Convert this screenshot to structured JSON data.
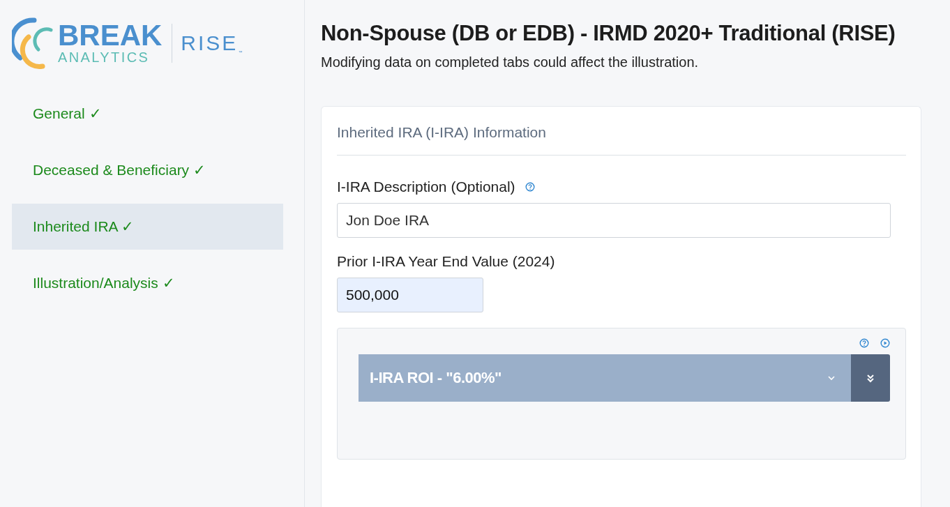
{
  "logo": {
    "brand": "BREAK",
    "subtitle": "ANALYTICS",
    "product": "RISE",
    "trademark": "™"
  },
  "nav": [
    {
      "label": "General",
      "status_icon": "✓",
      "completed": true,
      "selected": false
    },
    {
      "label": "Deceased & Beneficiary",
      "status_icon": "✓",
      "completed": true,
      "selected": false
    },
    {
      "label": "Inherited IRA",
      "status_icon": "✓",
      "completed": true,
      "selected": true
    },
    {
      "label": "Illustration/Analysis",
      "status_icon": "✓",
      "completed": true,
      "selected": false
    }
  ],
  "header": {
    "title": "Non-Spouse (DB or EDB) - IRMD 2020+ Traditional (RISE)",
    "subtitle": "Modifying data on completed tabs could affect the illustration."
  },
  "card": {
    "section_title": "Inherited IRA (I-IRA) Information",
    "fields": [
      {
        "label": "I-IRA Description (Optional)",
        "help": true,
        "value": "Jon Doe IRA",
        "kind": "text"
      },
      {
        "label": "Prior I-IRA Year End Value (2024)",
        "help": false,
        "value": "500,000",
        "kind": "amount"
      }
    ],
    "roi_panel": {
      "dropdown_value": "I-IRA ROI - \"6.00%\""
    }
  }
}
